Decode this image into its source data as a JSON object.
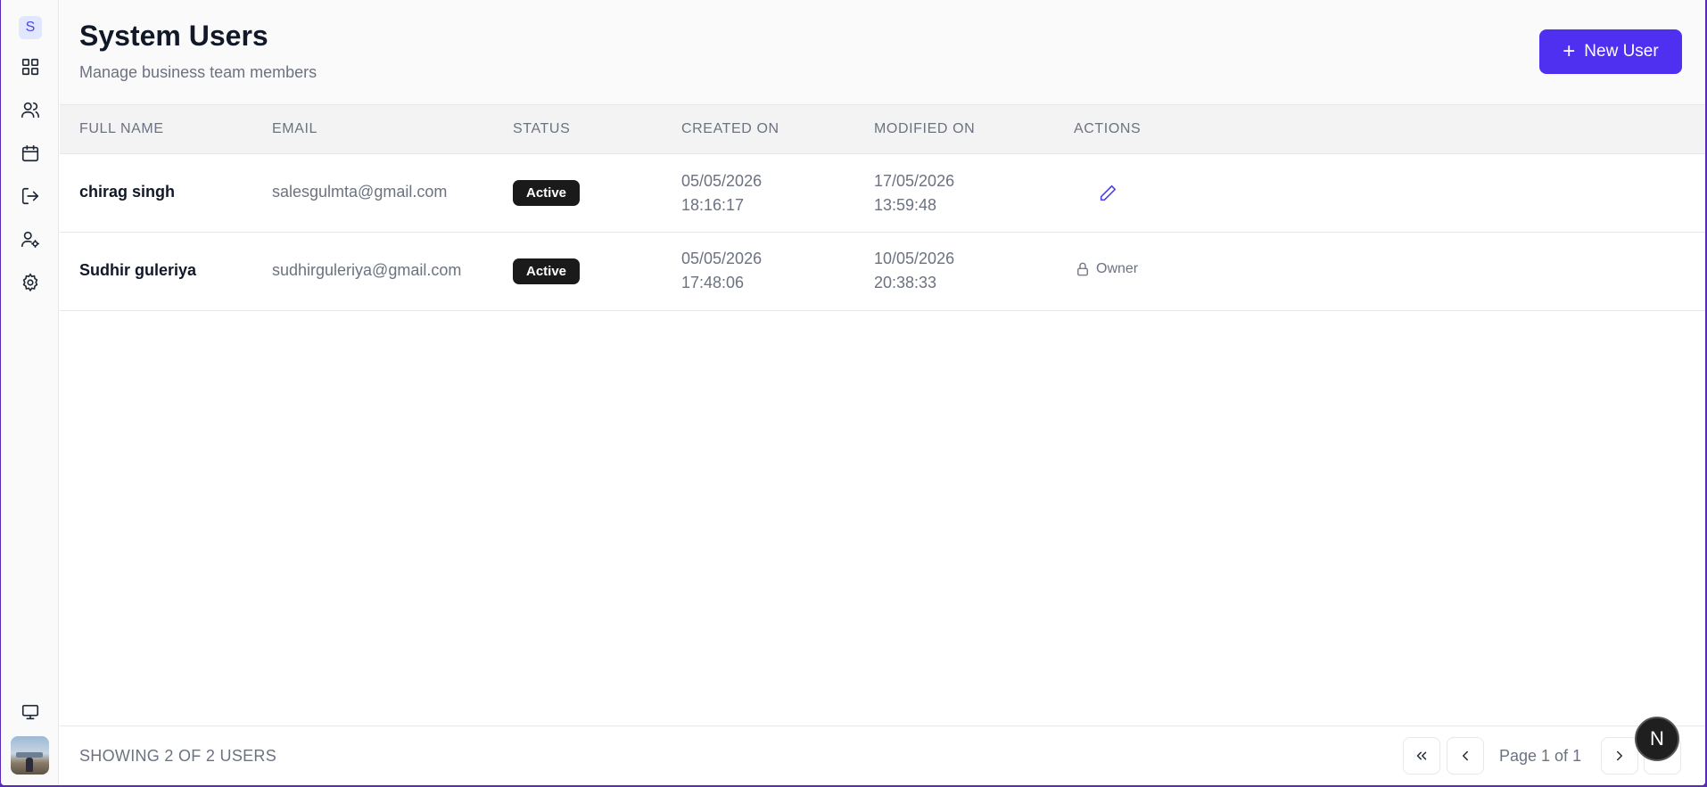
{
  "sidebar": {
    "brand_letter": "S",
    "items": [
      {
        "icon": "dashboard-grid-icon"
      },
      {
        "icon": "users-icon"
      },
      {
        "icon": "calendar-icon"
      },
      {
        "icon": "logout-icon"
      },
      {
        "icon": "user-settings-icon"
      },
      {
        "icon": "gear-icon"
      },
      {
        "icon": "monitor-icon"
      }
    ]
  },
  "header": {
    "title": "System Users",
    "subtitle": "Manage business team members",
    "new_button_label": "New User",
    "accent_color": "#4f2ff0"
  },
  "table": {
    "columns": [
      "Full Name",
      "Email",
      "Status",
      "Created On",
      "Modified On",
      "Actions"
    ],
    "rows": [
      {
        "name": "chirag singh",
        "email": "salesgulmta@gmail.com",
        "status": "Active",
        "created_date": "05/05/2026",
        "created_time": "18:16:17",
        "modified_date": "17/05/2026",
        "modified_time": "13:59:48",
        "action": "edit-icon"
      },
      {
        "name": "Sudhir guleriya",
        "email": "sudhirguleriya@gmail.com",
        "status": "Active",
        "created_date": "05/05/2026",
        "created_time": "17:48:06",
        "modified_date": "10/05/2026",
        "modified_time": "20:38:33",
        "action_label": "Owner"
      }
    ]
  },
  "footer": {
    "showing": "SHOWING 2 OF 2 USERS",
    "page_info": "Page 1 of 1"
  },
  "fab_letter": "N"
}
